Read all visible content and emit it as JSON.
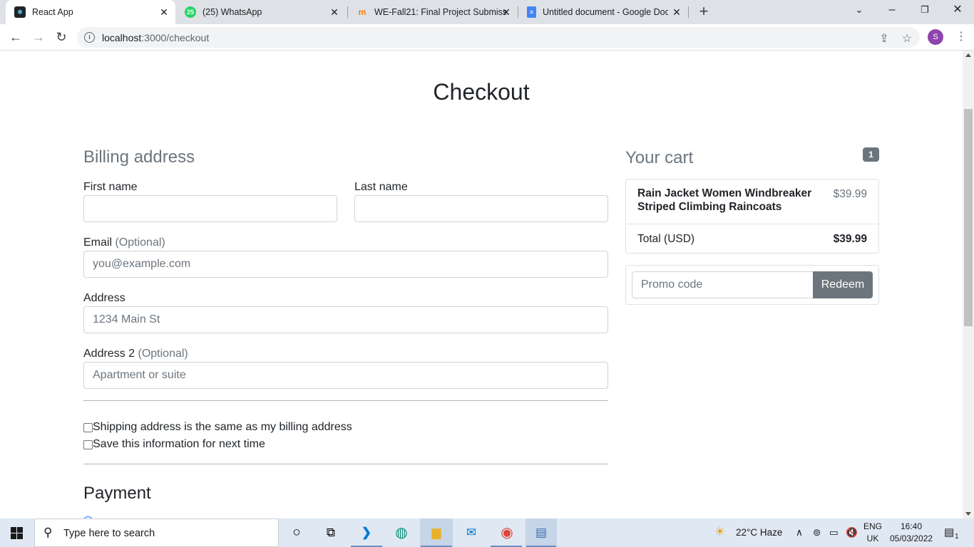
{
  "browser": {
    "tabs": [
      {
        "title": "React App",
        "icon": "react-icon"
      },
      {
        "title": "(25) WhatsApp",
        "icon": "whatsapp-icon",
        "badge": "25"
      },
      {
        "title": "WE-Fall21: Final Project Submissi",
        "icon": "moodle-icon"
      },
      {
        "title": "Untitled document - Google Doc",
        "icon": "google-docs-icon"
      }
    ],
    "url_host": "localhost",
    "url_path": ":3000/checkout",
    "profile_initial": "S"
  },
  "page": {
    "title": "Checkout",
    "billing": {
      "heading": "Billing address",
      "first_name_label": "First name",
      "last_name_label": "Last name",
      "email_label": "Email",
      "optional": "(Optional)",
      "email_placeholder": "you@example.com",
      "address_label": "Address",
      "address_placeholder": "1234 Main St",
      "address2_label": "Address 2",
      "address2_placeholder": "Apartment or suite",
      "same_address": "Shipping address is the same as my billing address",
      "save_info": "Save this information for next time"
    },
    "payment_heading": "Payment",
    "cart": {
      "heading": "Your cart",
      "count": "1",
      "items": [
        {
          "name": "Rain Jacket Women Windbreaker Striped Climbing Raincoats",
          "price": "$39.99"
        }
      ],
      "total_label": "Total (USD)",
      "total_value": "$39.99",
      "promo_placeholder": "Promo code",
      "redeem_label": "Redeem"
    }
  },
  "taskbar": {
    "search_placeholder": "Type here to search",
    "weather": "22°C  Haze",
    "lang_line1": "ENG",
    "lang_line2": "UK",
    "time": "16:40",
    "date": "05/03/2022",
    "notification_count": "1"
  }
}
